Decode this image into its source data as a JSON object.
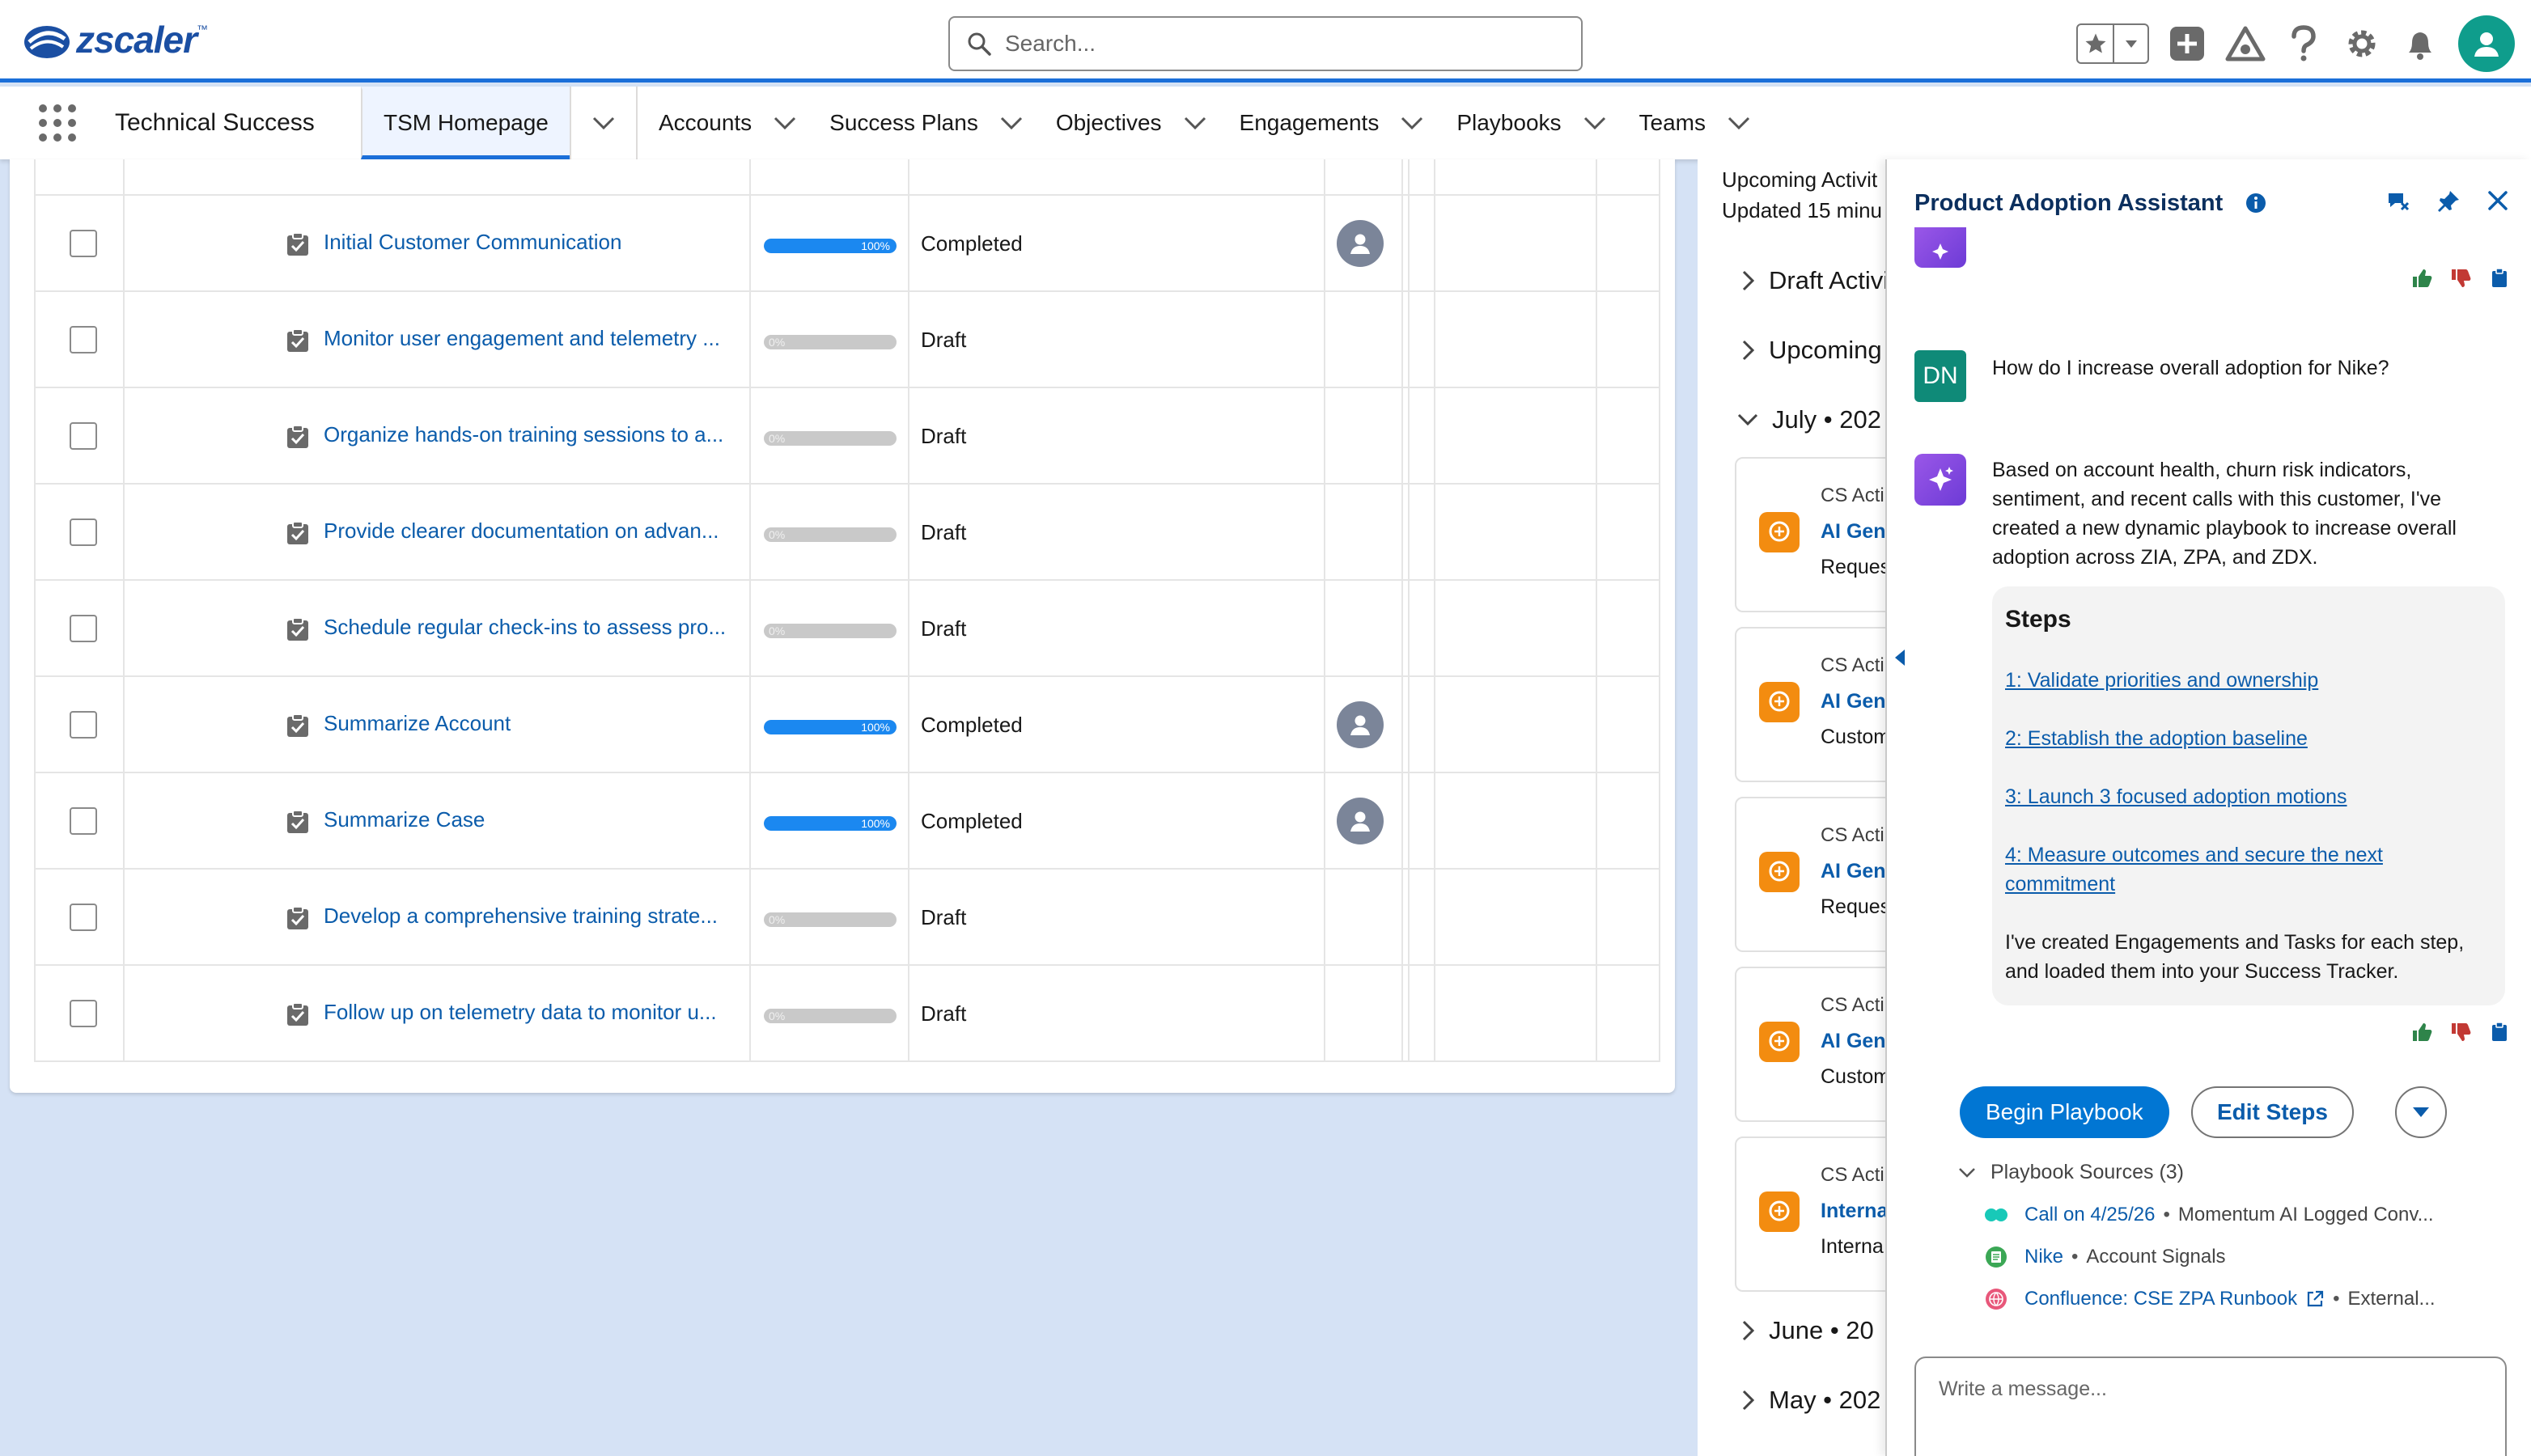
{
  "brand": {
    "name": "zscaler",
    "tm": "™"
  },
  "search": {
    "placeholder": "Search..."
  },
  "nav": {
    "app_name": "Technical Success",
    "active_tab": "TSM Homepage",
    "items": [
      "Accounts",
      "Success Plans",
      "Objectives",
      "Engagements",
      "Playbooks",
      "Teams"
    ]
  },
  "tasks": {
    "rows": [
      {
        "name": "Initial Customer Communication",
        "progress": 100,
        "progress_label": "100%",
        "status": "Completed",
        "has_owner": true
      },
      {
        "name": "Monitor user engagement and telemetry ...",
        "progress": 0,
        "progress_label": "0%",
        "status": "Draft",
        "has_owner": false
      },
      {
        "name": "Organize hands-on training sessions to a...",
        "progress": 0,
        "progress_label": "0%",
        "status": "Draft",
        "has_owner": false
      },
      {
        "name": "Provide clearer documentation on advan...",
        "progress": 0,
        "progress_label": "0%",
        "status": "Draft",
        "has_owner": false
      },
      {
        "name": "Schedule regular check-ins to assess pro...",
        "progress": 0,
        "progress_label": "0%",
        "status": "Draft",
        "has_owner": false
      },
      {
        "name": "Summarize Account",
        "progress": 100,
        "progress_label": "100%",
        "status": "Completed",
        "has_owner": true
      },
      {
        "name": "Summarize Case",
        "progress": 100,
        "progress_label": "100%",
        "status": "Completed",
        "has_owner": true
      },
      {
        "name": "Develop a comprehensive training strate...",
        "progress": 0,
        "progress_label": "0%",
        "status": "Draft",
        "has_owner": false
      },
      {
        "name": "Follow up on telemetry data to monitor u...",
        "progress": 0,
        "progress_label": "0%",
        "status": "Draft",
        "has_owner": false
      }
    ]
  },
  "activity": {
    "header_line1": "Upcoming Activit",
    "header_line2": "Updated 15 minu",
    "section_draft": "Draft Activi",
    "section_upcoming": "Upcoming",
    "section_july": "July • 202",
    "section_june": "June • 20",
    "section_may": "May • 202",
    "cards": [
      {
        "l1": "CS Acti",
        "l2": "AI Gen",
        "l3": "Reques"
      },
      {
        "l1": "CS Acti",
        "l2": "AI Gen",
        "l3": "Custom"
      },
      {
        "l1": "CS Acti",
        "l2": "AI Gen",
        "l3": "Reques"
      },
      {
        "l1": "CS Acti",
        "l2": "AI Gen",
        "l3": "Custom"
      },
      {
        "l1": "CS Acti",
        "l2": "Interna",
        "l3": "Interna"
      }
    ]
  },
  "assistant": {
    "title": "Product Adoption Assistant",
    "user_initials": "DN",
    "user_message": "How do I increase overall adoption for Nike?",
    "bot_message": "Based on account health, churn risk indicators, sentiment, and recent calls with this customer, I've created a new dynamic playbook to increase overall adoption across ZIA, ZPA, and ZDX.",
    "steps_title": "Steps",
    "steps": [
      "1: Validate priorities and ownership",
      "2: Establish the adoption baseline",
      "3: Launch 3 focused adoption motions",
      "4: Measure outcomes and secure the next commitment"
    ],
    "steps_note": "I've created Engagements and Tasks for each step, and loaded them into your Success Tracker.",
    "begin_label": "Begin Playbook",
    "edit_label": "Edit Steps",
    "sources_label": "Playbook Sources (3)",
    "sources": [
      {
        "link": "Call on 4/25/26",
        "type": "Momentum AI Logged Conv..."
      },
      {
        "link": "Nike",
        "type": "Account Signals"
      },
      {
        "link": "Confluence: CSE ZPA Runbook",
        "type": "External..."
      }
    ],
    "composer_placeholder": "Write a message...",
    "colors": {
      "thumbs_up": "#2e844a",
      "thumbs_down": "#c23934",
      "copy": "#0b5cab"
    }
  }
}
